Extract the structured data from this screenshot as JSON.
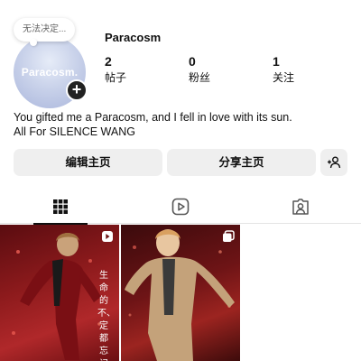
{
  "profile": {
    "note": "无法决定...",
    "avatar_text": "Paracosm.",
    "username": "Paracosm",
    "bio_line1": "You gifted me a Paracosm, and I fell in love with its sun.",
    "bio_line2": "All For SILENCE WANG"
  },
  "stats": [
    {
      "value": "2",
      "label": "帖子"
    },
    {
      "value": "0",
      "label": "粉丝"
    },
    {
      "value": "1",
      "label": "关注"
    }
  ],
  "buttons": {
    "edit": "编辑主页",
    "share": "分享主页",
    "add_person_icon": "add-person-icon"
  },
  "tabs": [
    {
      "icon": "grid-icon",
      "active": true
    },
    {
      "icon": "reels-icon",
      "active": false
    },
    {
      "icon": "tagged-icon",
      "active": false
    }
  ],
  "posts": [
    {
      "caption": "生命的不、定都忘记",
      "badge": "reel-icon"
    },
    {
      "caption": "",
      "badge": "multi-photo-icon"
    }
  ],
  "colors": {
    "button_bg": "#efefef",
    "text": "#111111",
    "avatar_gradient_end": "#aab6dc"
  }
}
